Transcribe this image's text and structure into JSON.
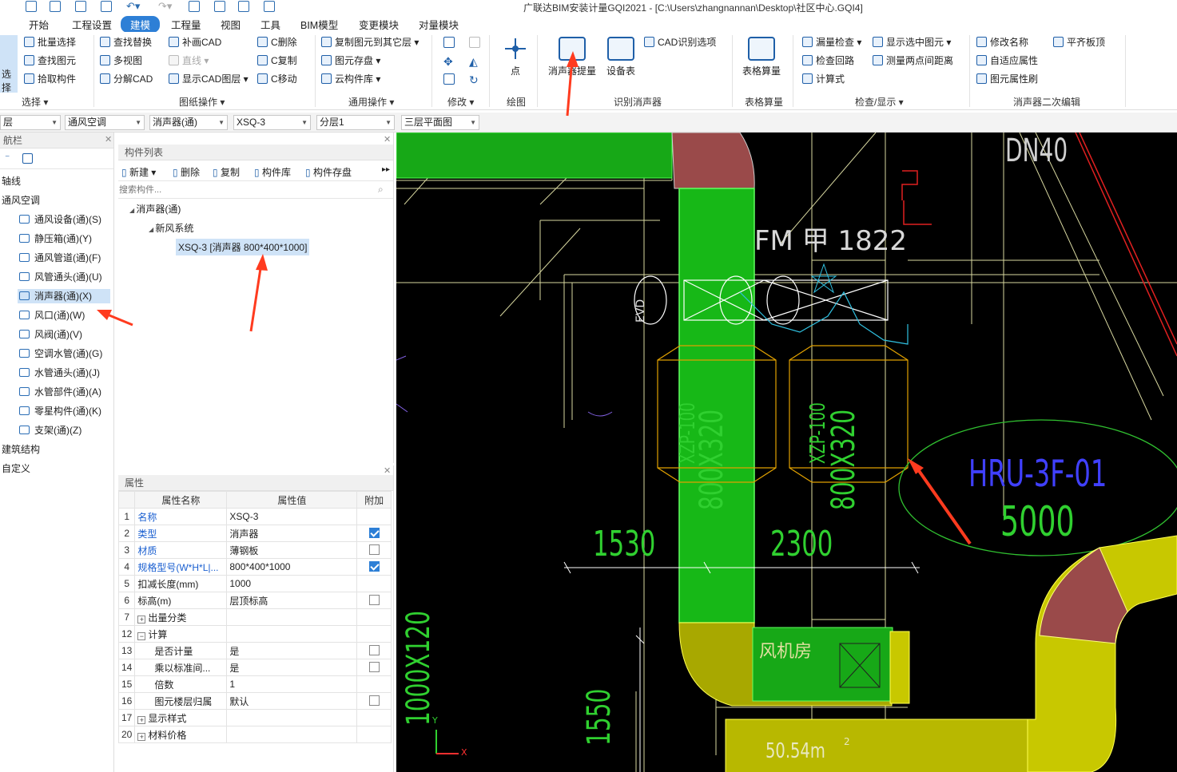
{
  "window": {
    "title": "广联达BIM安装计量GQI2021 - [C:\\Users\\zhangnannan\\Desktop\\社区中心.GQI4]"
  },
  "menu": {
    "tabs": [
      "开始",
      "工程设置",
      "建模",
      "工程量",
      "视图",
      "工具",
      "BIM模型",
      "变更模块",
      "对量模块"
    ],
    "active": "建模"
  },
  "ribbon": {
    "select": {
      "big": "选择",
      "items": [
        "批量选择",
        "查找图元",
        "拾取构件"
      ],
      "group": "选择"
    },
    "drawing_ops": {
      "items": [
        "查找替换",
        "多视图",
        "分解CAD",
        "补画CAD",
        "直线",
        "显示CAD图层",
        "C删除",
        "C复制",
        "C移动"
      ],
      "group": "图纸操作"
    },
    "general_ops": {
      "items": [
        "复制图元到其它层",
        "图元存盘",
        "云构件库"
      ],
      "group": "通用操作"
    },
    "modify": {
      "group": "修改"
    },
    "draw": {
      "big": "点",
      "group": "绘图"
    },
    "recognize": {
      "big1": "消声器提量",
      "big2": "设备表",
      "item": "CAD识别选项",
      "group": "识别消声器"
    },
    "table_calc": {
      "big": "表格算量",
      "group": "表格算量"
    },
    "check": {
      "items": [
        "漏量检查",
        "检查回路",
        "计算式",
        "显示选中图元",
        "测量两点间距离"
      ],
      "group": "检查/显示"
    },
    "edit2": {
      "items": [
        "修改名称",
        "自适应属性",
        "图元属性刷",
        "平齐板顶"
      ],
      "group": "消声器二次编辑"
    }
  },
  "selectors": [
    "层",
    "通风空调",
    "消声器(通)",
    "XSQ-3",
    "分层1",
    "三层平面图"
  ],
  "nav": {
    "title": "航栏",
    "items": [
      {
        "label": "轴线",
        "level": 0
      },
      {
        "label": "通风空调",
        "level": 0
      },
      {
        "label": "通风设备(通)(S)",
        "level": 1
      },
      {
        "label": "静压箱(通)(Y)",
        "level": 1
      },
      {
        "label": "通风管道(通)(F)",
        "level": 1
      },
      {
        "label": "风管通头(通)(U)",
        "level": 1
      },
      {
        "label": "消声器(通)(X)",
        "level": 1,
        "selected": true
      },
      {
        "label": "风口(通)(W)",
        "level": 1
      },
      {
        "label": "风阀(通)(V)",
        "level": 1
      },
      {
        "label": "空调水管(通)(G)",
        "level": 1
      },
      {
        "label": "水管通头(通)(J)",
        "level": 1
      },
      {
        "label": "水管部件(通)(A)",
        "level": 1
      },
      {
        "label": "零星构件(通)(K)",
        "level": 1
      },
      {
        "label": "支架(通)(Z)",
        "level": 1
      },
      {
        "label": "建筑结构",
        "level": 0
      },
      {
        "label": "自定义",
        "level": 0
      }
    ]
  },
  "components": {
    "title": "构件列表",
    "toolbar": [
      "新建",
      "删除",
      "复制",
      "构件库",
      "构件存盘"
    ],
    "search_placeholder": "搜索构件...",
    "tree": {
      "root": "消声器(通)",
      "child": "新风系统",
      "leaf": "XSQ-3 [消声器 800*400*1000]"
    }
  },
  "properties": {
    "title": "属性",
    "headers": [
      "属性名称",
      "属性值",
      "附加"
    ],
    "rows": [
      {
        "n": "1",
        "name": "名称",
        "value": "XSQ-3",
        "blue": true,
        "chk": null
      },
      {
        "n": "2",
        "name": "类型",
        "value": "消声器",
        "blue": true,
        "chk": true
      },
      {
        "n": "3",
        "name": "材质",
        "value": "薄钢板",
        "blue": true,
        "chk": false
      },
      {
        "n": "4",
        "name": "规格型号(W*H*L|...",
        "value": "800*400*1000",
        "blue": true,
        "chk": true
      },
      {
        "n": "5",
        "name": "扣减长度(mm)",
        "value": "1000",
        "blue": false,
        "chk": null
      },
      {
        "n": "6",
        "name": "标高(m)",
        "value": "层顶标高",
        "blue": false,
        "chk": false
      },
      {
        "n": "7",
        "name": "出量分类",
        "value": "",
        "blue": false,
        "chk": null,
        "exp": "+"
      },
      {
        "n": "12",
        "name": "计算",
        "value": "",
        "blue": false,
        "chk": null,
        "exp": "−"
      },
      {
        "n": "13",
        "name": "是否计量",
        "value": "是",
        "blue": false,
        "chk": false,
        "indent": true
      },
      {
        "n": "14",
        "name": "乘以标准间...",
        "value": "是",
        "blue": false,
        "chk": false,
        "indent": true
      },
      {
        "n": "15",
        "name": "倍数",
        "value": "1",
        "blue": false,
        "chk": null,
        "indent": true
      },
      {
        "n": "16",
        "name": "图元楼层归属",
        "value": "默认",
        "blue": false,
        "chk": false,
        "indent": true
      },
      {
        "n": "17",
        "name": "显示样式",
        "value": "",
        "blue": false,
        "chk": null,
        "exp": "+"
      },
      {
        "n": "20",
        "name": "材料价格",
        "value": "",
        "blue": false,
        "chk": null,
        "exp": "+"
      }
    ]
  },
  "cad": {
    "texts": {
      "room": "FM 甲 1822",
      "hru_name": "HRU-3F-01",
      "hru_value": "5000",
      "dim1": "1530",
      "dim2": "2300",
      "dim3": "1550",
      "duct_v": "1000X120",
      "silencer_model1": "XZP-100",
      "silencer_size1": "800X320",
      "silencer_model2": "XZP-100",
      "silencer_size2": "800X320",
      "fan_room": "风机房",
      "area": "50.54m",
      "area_sup": "2",
      "evd": "EVD",
      "topright": "DN40",
      "axis_y": "Y",
      "axis_x": "X"
    }
  },
  "colors": {
    "accent": "#2d7fd6",
    "annotation": "#ff3b1f",
    "cad_bg": "#000000",
    "duct_green": "#17c617",
    "duct_yellow": "#c8c800",
    "elbow_red": "#a05050"
  }
}
